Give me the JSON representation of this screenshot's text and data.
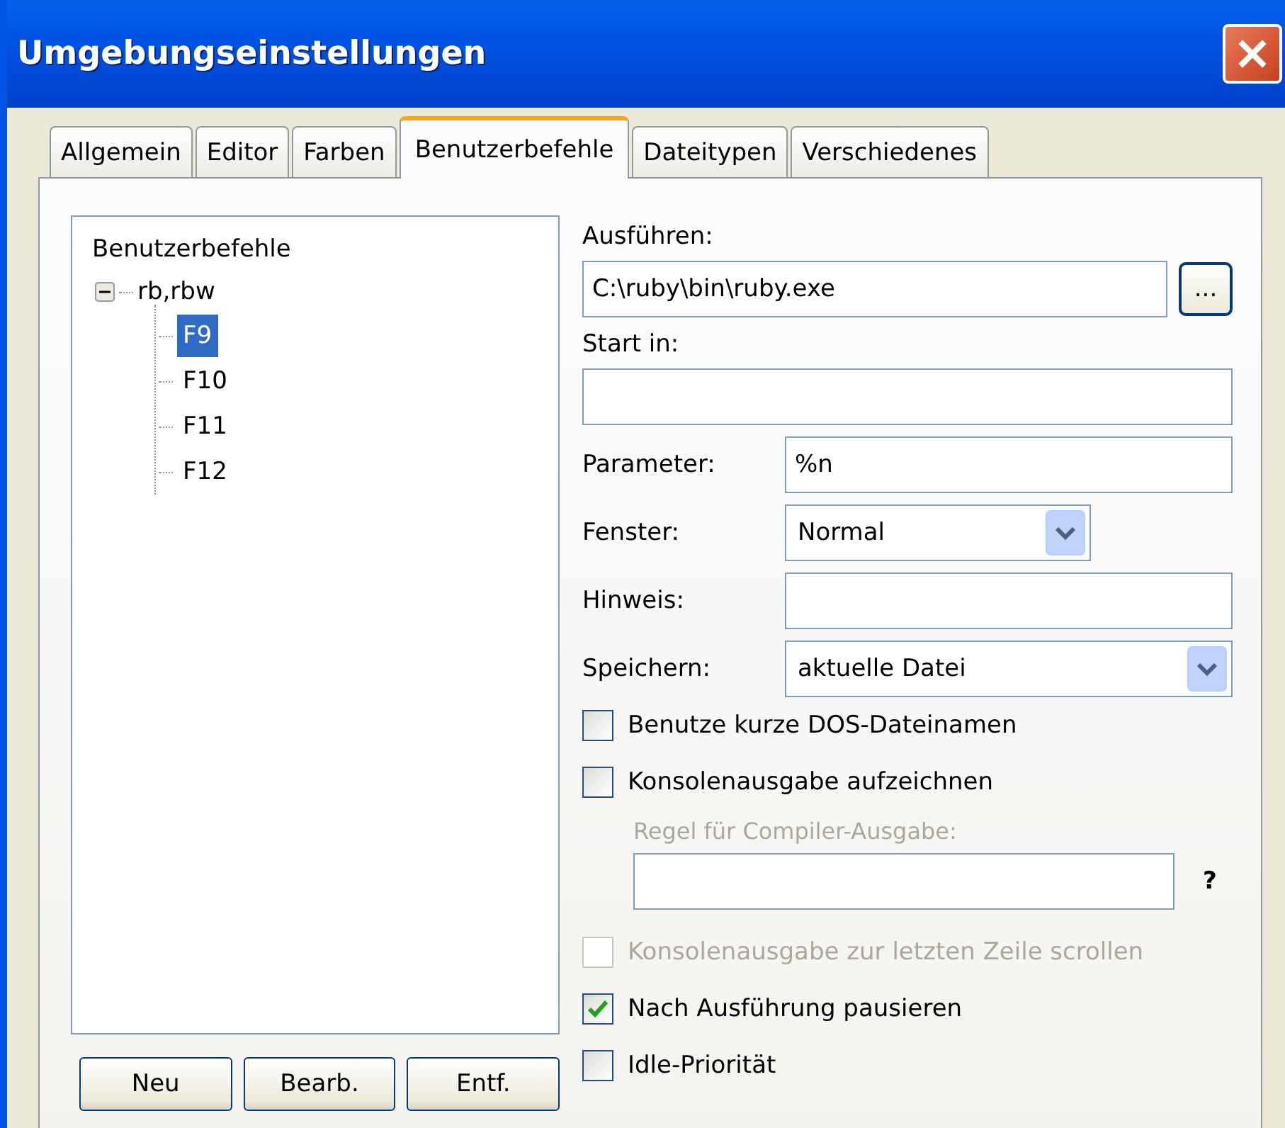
{
  "window": {
    "title": "Umgebungseinstellungen"
  },
  "tabs": [
    {
      "label": "Allgemein",
      "selected": false
    },
    {
      "label": "Editor",
      "selected": false
    },
    {
      "label": "Farben",
      "selected": false
    },
    {
      "label": "Benutzerbefehle",
      "selected": true
    },
    {
      "label": "Dateitypen",
      "selected": false
    },
    {
      "label": "Verschiedenes",
      "selected": false
    }
  ],
  "tree": {
    "root": "Benutzerbefehle",
    "items": [
      {
        "label": "rb,rbw",
        "expanded": true,
        "children": [
          {
            "label": "F9",
            "selected": true
          },
          {
            "label": "F10",
            "selected": false
          },
          {
            "label": "F11",
            "selected": false
          },
          {
            "label": "F12",
            "selected": false
          }
        ]
      }
    ]
  },
  "tree_buttons": [
    "Neu",
    "Bearb.",
    "Entf."
  ],
  "execute": {
    "label": "Ausführen:",
    "value": "C:\\ruby\\bin\\ruby.exe",
    "browse": "..."
  },
  "start_in": {
    "label": "Start in:"
  },
  "rows": [
    {
      "label": "Parameter:",
      "kind": "text",
      "value": "%n"
    },
    {
      "label": "Fenster:",
      "kind": "short-select",
      "value": "Normal"
    },
    {
      "label": "Hinweis:",
      "kind": "text"
    },
    {
      "label": "Speichern:",
      "kind": "select",
      "value": "aktuelle Datei"
    }
  ],
  "options": [
    {
      "kind": "checkbox",
      "label": "Benutze kurze DOS-Dateinamen",
      "checked": false,
      "disabled": false
    },
    {
      "kind": "checkbox",
      "label": "Konsolenausgabe aufzeichnen",
      "checked": false,
      "disabled": false
    },
    {
      "kind": "rule-field",
      "label": "Regel für Compiler-Ausgabe:",
      "help": "?",
      "disabled": true
    },
    {
      "kind": "checkbox",
      "label": "Konsolenausgabe zur letzten Zeile scrollen",
      "checked": false,
      "disabled": true
    },
    {
      "kind": "checkbox",
      "label": "Nach Ausführung pausieren",
      "checked": true,
      "disabled": false
    },
    {
      "kind": "checkbox",
      "label": "Idle-Priorität",
      "checked": false,
      "disabled": false
    }
  ]
}
